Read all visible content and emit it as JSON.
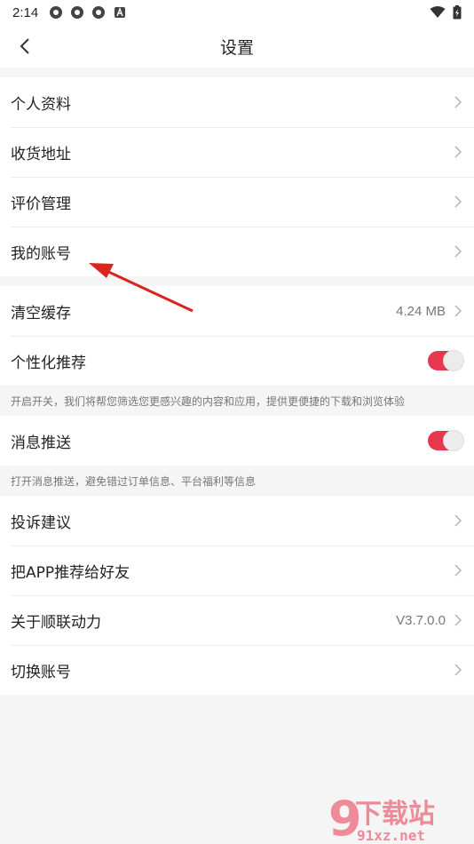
{
  "status_bar": {
    "time": "2:14"
  },
  "header": {
    "title": "设置"
  },
  "group1": [
    {
      "label": "个人资料"
    },
    {
      "label": "收货地址"
    },
    {
      "label": "评价管理"
    },
    {
      "label": "我的账号"
    }
  ],
  "cache": {
    "label": "清空缓存",
    "value": "4.24 MB"
  },
  "recommend": {
    "label": "个性化推荐",
    "on": true,
    "hint": "开启开关，我们将帮您筛选您更感兴趣的内容和应用，提供更便捷的下载和浏览体验"
  },
  "push": {
    "label": "消息推送",
    "on": true,
    "hint": "打开消息推送，避免错过订单信息、平台福利等信息"
  },
  "group3": {
    "complaint": "投诉建议",
    "share": "把APP推荐给好友",
    "about": "关于顺联动力",
    "about_value": "V3.7.0.0",
    "switch_account": "切换账号"
  },
  "watermark": {
    "brand": "下载站",
    "site": "91xz.net"
  },
  "colors": {
    "accent": "#e8364e",
    "annotation_arrow": "#d9241f"
  }
}
